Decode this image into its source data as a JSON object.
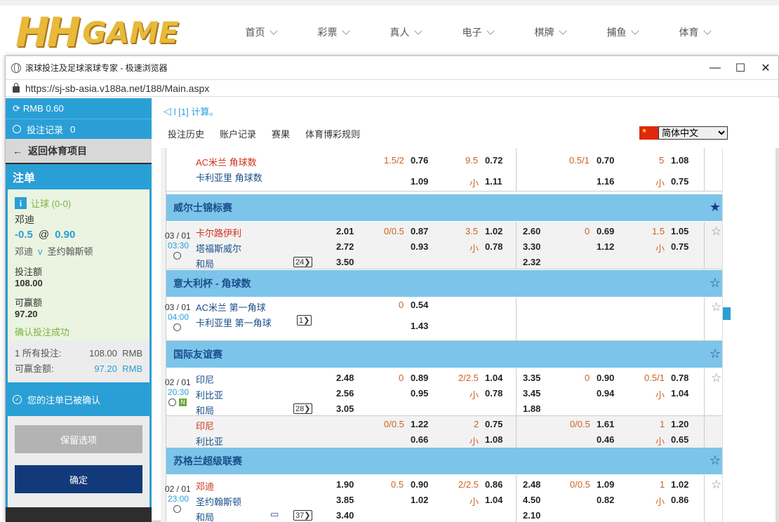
{
  "site": {
    "logo_hh": "HH",
    "logo_game": "GAME",
    "nav": [
      "首页",
      "彩票",
      "真人",
      "电子",
      "棋牌",
      "捕鱼",
      "体育"
    ]
  },
  "window": {
    "title": "滚球投注及足球滚球专家 - 极速浏览器",
    "url": "https://sj-sb-asia.v188a.net/188/Main.aspx",
    "min": "—",
    "max": "☐",
    "close": "✕"
  },
  "left": {
    "balance": "RMB 0.60",
    "records_label": "投注记录",
    "records_count": "0",
    "back_label": "返回体育项目",
    "slip_title": "注单",
    "market": "让球 (0-0)",
    "selection": "邓迪",
    "handicap": "-0.5",
    "at": "@",
    "price": "0.90",
    "home": "邓迪",
    "vs": "v",
    "away": "圣约翰斯顿",
    "stake_label": "投注额",
    "stake": "108.00",
    "win_label": "可赢额",
    "win": "97.20",
    "confirm_ok": "确认投注成功",
    "sum_count": "1",
    "sum_all": "所有投注:",
    "sum_all_amount": "108.00",
    "sum_all_cur": "RMB",
    "sum_win": "可赢金额:",
    "sum_win_amount": "97.20",
    "sum_win_cur": "RMB",
    "confirmed": "您的注单已被确认",
    "keep": "保留选项",
    "ok": "确定"
  },
  "right": {
    "ticker": "l [1] 计算。",
    "menu": [
      "投注历史",
      "账户记录",
      "赛果",
      "体育博彩规则"
    ],
    "language": "简体中文"
  },
  "leagues": {
    "wales": "威尔士锦标赛",
    "italy": "意大利杯 - 角球数",
    "intl": "国际友谊赛",
    "scot": "苏格兰超级联赛"
  },
  "rows": {
    "corner_top": {
      "home": "AC米兰 角球数",
      "away": "卡利亚里 角球数",
      "h1": "1.5/2",
      "o1": "0.76",
      "o1b": "1.09",
      "g1": "9.5",
      "o2": "0.72",
      "u1": "小",
      "o2b": "1.11",
      "h2": "0.5/1",
      "o3": "0.70",
      "o3b": "1.16",
      "g2": "5",
      "o4": "1.08",
      "u2": "小",
      "o4b": "0.75"
    },
    "cardiff": {
      "date": "03 / 01",
      "time": "03:30",
      "home": "卡尔路伊利",
      "away": "塔福斯威尔",
      "draw": "和局",
      "more": "24",
      "x1": "2.01",
      "x2": "2.72",
      "x3": "3.50",
      "h1": "0/0.5",
      "o1": "0.87",
      "o1b": "0.93",
      "g1": "3.5",
      "o2": "1.02",
      "u1": "小",
      "o2b": "0.78",
      "y1": "2.60",
      "y2": "3.30",
      "y3": "2.32",
      "h2": "0",
      "o3": "0.69",
      "o3b": "1.12",
      "g2": "1.5",
      "o4": "1.05",
      "u2": "小",
      "o4b": "0.75"
    },
    "milan_first": {
      "date": "03 / 01",
      "time": "04:00",
      "home": "AC米兰 第一角球",
      "away": "卡利亚里 第一角球",
      "more": "1",
      "h1": "0",
      "o1": "0.54",
      "o1b": "1.43"
    },
    "indonesia": {
      "date": "02 / 01",
      "time": "20:30",
      "live": "N",
      "home": "印尼",
      "away": "利比亚",
      "draw": "和局",
      "more": "28",
      "x1": "2.48",
      "x2": "2.56",
      "x3": "3.05",
      "h1": "0",
      "o1": "0.89",
      "o1b": "0.95",
      "g1": "2/2.5",
      "o2": "1.04",
      "u1": "小",
      "o2b": "0.78",
      "y1": "3.35",
      "y2": "3.45",
      "y3": "1.88",
      "h2": "0",
      "o3": "0.90",
      "o3b": "0.94",
      "g2": "0.5/1",
      "o4": "0.78",
      "u2": "小",
      "o4b": "1.04"
    },
    "indonesia2": {
      "home": "印尼",
      "away": "利比亚",
      "h1": "0/0.5",
      "o1": "1.22",
      "o1b": "0.66",
      "g1": "2",
      "o2": "0.75",
      "u1": "小",
      "o2b": "1.08",
      "h2": "0/0.5",
      "o3": "1.61",
      "o3b": "0.46",
      "g2": "1",
      "o4": "1.20",
      "u2": "小",
      "o4b": "0.65"
    },
    "dundee": {
      "date": "02 / 01",
      "time": "23:00",
      "home": "邓迪",
      "away": "圣约翰斯顿",
      "draw": "和局",
      "more": "37",
      "x1": "1.90",
      "x2": "3.85",
      "x3": "3.40",
      "h1": "0.5",
      "o1": "0.90",
      "o1b": "1.02",
      "g1": "2/2.5",
      "o2": "0.86",
      "u1": "小",
      "o2b": "1.04",
      "y1": "2.48",
      "y2": "4.50",
      "y3": "2.10",
      "h2": "0/0.5",
      "o3": "1.09",
      "o3b": "0.82",
      "g2": "1",
      "o4": "1.02",
      "u2": "小",
      "o4b": "0.86"
    }
  }
}
